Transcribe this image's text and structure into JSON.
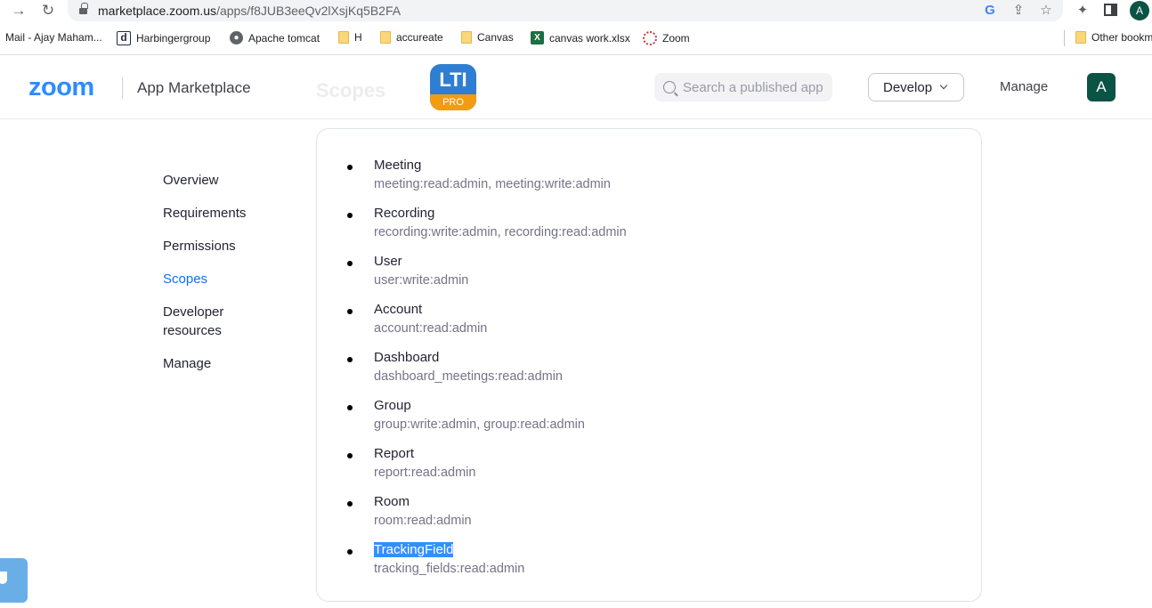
{
  "browser": {
    "url_host": "marketplace.zoom.us",
    "url_path": "/apps/f8JUB3eeQv2lXsjKq5B2FA",
    "profile_initial": "A",
    "bookmarks": [
      {
        "label": "Mail - Ajay Maham...",
        "icon": "mail-icon"
      },
      {
        "label": "Harbingergroup",
        "icon": "d-icon"
      },
      {
        "label": "Apache tomcat",
        "icon": "globe-icon"
      },
      {
        "label": "H",
        "icon": "folder-icon"
      },
      {
        "label": "accureate",
        "icon": "folder-icon"
      },
      {
        "label": "Canvas",
        "icon": "folder-icon"
      },
      {
        "label": "canvas work.xlsx",
        "icon": "excel-icon"
      },
      {
        "label": "Zoom",
        "icon": "zoom-icon"
      },
      {
        "label": "Other bookm",
        "icon": "folder-icon"
      }
    ],
    "excel_glyph": "X",
    "d_glyph": "d"
  },
  "header": {
    "logo": "zoom",
    "marketplace": "App Marketplace",
    "ghost_title": "Scopes",
    "app_icon_top": "LTI",
    "app_icon_bottom": "PRO",
    "search_placeholder": "Search a published app",
    "develop_label": "Develop",
    "manage_label": "Manage",
    "avatar_initial": "A"
  },
  "leftnav": {
    "overview": "Overview",
    "requirements": "Requirements",
    "permissions": "Permissions",
    "scopes": "Scopes",
    "developer_resources": "Developer resources",
    "manage": "Manage"
  },
  "scopes": [
    {
      "name": "Meeting",
      "perms": "meeting:read:admin, meeting:write:admin"
    },
    {
      "name": "Recording",
      "perms": "recording:write:admin, recording:read:admin"
    },
    {
      "name": "User",
      "perms": "user:write:admin"
    },
    {
      "name": "Account",
      "perms": "account:read:admin"
    },
    {
      "name": "Dashboard",
      "perms": "dashboard_meetings:read:admin"
    },
    {
      "name": "Group",
      "perms": "group:write:admin, group:read:admin"
    },
    {
      "name": "Report",
      "perms": "report:read:admin"
    },
    {
      "name": "Room",
      "perms": "room:read:admin"
    },
    {
      "name": "TrackingField",
      "perms": "tracking_fields:read:admin"
    }
  ],
  "colors": {
    "zoom_blue": "#2d8cff",
    "active_nav": "#0e72ed",
    "selection": "#338fff",
    "avatar": "#0b5345"
  }
}
